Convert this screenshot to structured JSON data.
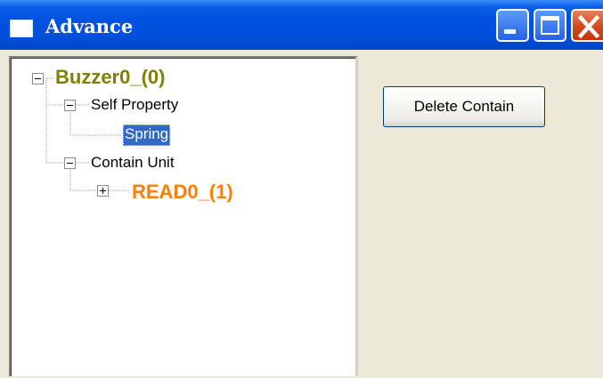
{
  "window": {
    "title": "Advance"
  },
  "tree": {
    "root": {
      "label": "Buzzer0_(0)",
      "expanded": true,
      "color": "#808000"
    },
    "groups": [
      {
        "label": "Self Property",
        "expanded": true,
        "children": [
          {
            "label": "Spring",
            "selected": true
          }
        ]
      },
      {
        "label": "Contain Unit",
        "expanded": true,
        "children": [
          {
            "label": "READ0_(1)",
            "expanded": false,
            "color": "#ff8000"
          }
        ]
      }
    ],
    "selection_color": "#316ac5"
  },
  "actions": {
    "delete_label": "Delete Contain"
  },
  "colors": {
    "titlebar": "#0050dd",
    "window_bg": "#ece9d8",
    "close_button": "#d3491e"
  }
}
